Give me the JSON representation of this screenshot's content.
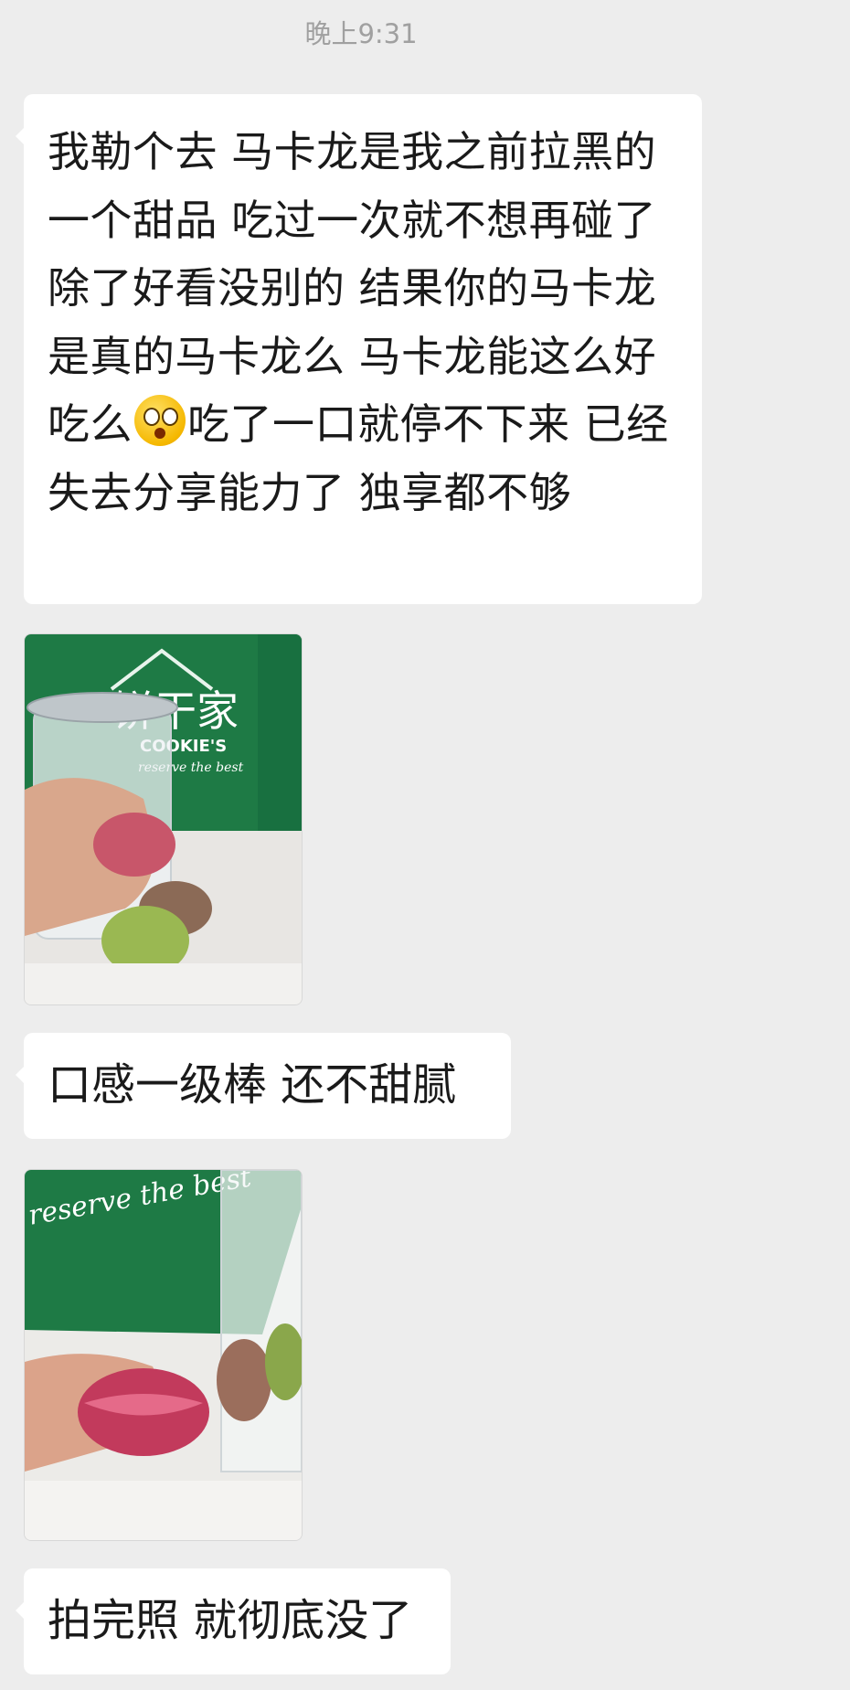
{
  "chat": {
    "timestamp": "晚上9:31",
    "messages": [
      {
        "type": "text",
        "text_before_emoji": "我勒个去  马卡龙是我之前拉黑的一个甜品 吃过一次就不想再碰了  除了好看没别的  结果你的马卡龙是真的马卡龙么  马卡龙能这么好吃么",
        "emoji": "astonished-face-icon",
        "text_after_emoji": "吃了一口就停不下来  已经失去分享能力了 独享都不够"
      },
      {
        "type": "image",
        "icon": "macaron-photo-jar"
      },
      {
        "type": "text",
        "text": "口感一级棒  还不甜腻"
      },
      {
        "type": "image",
        "icon": "macaron-photo-bite"
      },
      {
        "type": "text",
        "text": "拍完照 就彻底没了"
      }
    ]
  },
  "photo1_logo": {
    "brand": "饼干家",
    "brand_en": "COOKIE'S",
    "slogan": "reserve the best"
  },
  "photo2_logo": {
    "slogan": "reserve the best"
  },
  "colors": {
    "background": "#ededed",
    "bubble": "#ffffff",
    "bag_green": "#1e7a45"
  }
}
